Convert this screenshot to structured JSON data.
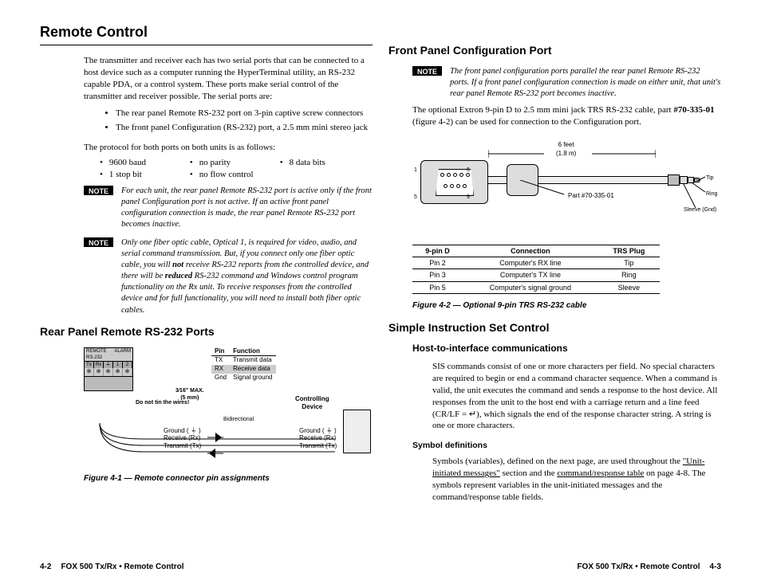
{
  "left": {
    "h1": "Remote Control",
    "intro": "The transmitter and receiver each has two serial ports that can be connected to a host device such as a computer running the HyperTerminal utility, an RS-232 capable PDA, or a control system. These ports make serial control of the transmitter and receiver possible. The serial ports are:",
    "ports": [
      "The rear panel Remote RS-232 port on 3-pin captive screw connectors",
      "The front panel Configuration (RS-232) port, a 2.5 mm mini stereo jack"
    ],
    "protocol_intro": "The protocol for both ports on both units is as follows:",
    "protocol": [
      "9600 baud",
      "no parity",
      "8 data bits",
      "1 stop bit",
      "no flow control"
    ],
    "note_label": "NOTE",
    "note1": "For each unit, the rear panel Remote RS-232 port is active only if the front panel Configuration port is not active. If an active front panel configuration connection is made, the rear panel Remote RS-232 port becomes inactive.",
    "note2_a": "Only one fiber optic cable, Optical 1, is required for video, audio, and serial command transmission. But, if you connect only one fiber optic cable, you will ",
    "note2_not": "not",
    "note2_b": " receive RS-232 reports from the controlled device, and there will be ",
    "note2_red": "reduced",
    "note2_c": " RS-232 command and Windows control program functionality on the Rx unit. To receive responses from the controlled device and for full functionality, you will need to install both fiber optic cables.",
    "h2_rear": "Rear Panel Remote RS-232 Ports",
    "fig41": {
      "remote": "REMOTE\nRS-232",
      "alarm": "ALARM",
      "row": [
        "Tx",
        "Rx",
        "⏚",
        "1",
        "2"
      ],
      "pin_hdr": [
        "Pin",
        "Function"
      ],
      "pins": [
        [
          "TX",
          "Transmit data"
        ],
        [
          "RX",
          "Receive data"
        ],
        [
          "Gnd",
          "Signal ground"
        ]
      ],
      "max1": "3⁄16\" MAX.",
      "max2": "(5 mm)",
      "tin": "Do not tin the wires!",
      "ctrl": "Controlling\nDevice",
      "bidi": "Bidirectional",
      "labels_l": "Ground ( ⏚ )\nReceive (Rx)\nTransmit (Tx)",
      "labels_r": "Ground ( ⏚ )\nReceive (Rx)\nTransmit (Tx)"
    },
    "fig41_caption": "Figure 4-1 — Remote connector pin assignments",
    "footer_page": "4-2",
    "footer_text": "FOX 500 Tx/Rx • Remote Control"
  },
  "right": {
    "h2_front": "Front Panel Configuration Port",
    "note_label": "NOTE",
    "note": "The front panel configuration ports parallel the rear panel Remote RS-232 ports. If a front panel configuration connection is made on either unit, that unit's rear panel Remote RS-232 port becomes inactive.",
    "para_a": "The optional Extron 9-pin D to 2.5 mm mini jack TRS RS-232 cable, part ",
    "para_part": "#70-335-01",
    "para_b": " (figure 4-2) can be used for connection to the Configuration port.",
    "fig42": {
      "len1": "6 feet",
      "len2": "(1.8 m)",
      "part": "Part #70-335-01",
      "pins": {
        "p1": "1",
        "p5": "5",
        "p6": "6",
        "p9": "9"
      },
      "trs": {
        "tip": "Tip",
        "ring": "Ring",
        "sleeve": "Sleeve (Gnd)"
      }
    },
    "table": {
      "headers": [
        "9-pin D",
        "Connection",
        "TRS Plug"
      ],
      "rows": [
        [
          "Pin 2",
          "Computer's RX line",
          "Tip"
        ],
        [
          "Pin 3",
          "Computer's TX line",
          "Ring"
        ],
        [
          "Pin 5",
          "Computer's signal ground",
          "Sleeve"
        ]
      ]
    },
    "fig42_caption": "Figure 4-2 — Optional 9-pin TRS RS-232 cable",
    "h2_sis": "Simple Instruction Set Control",
    "h3_host": "Host-to-interface communications",
    "sis_para": "SIS commands consist of one or more characters per field. No special characters are required to begin or end a command character sequence. When a command is valid, the unit executes the command and sends a response to the host device. All responses from the unit to the host end with a carriage return and a line feed (CR/LF = ↵), which signals the end of the response character string. A string is one or more characters.",
    "h4_sym": "Symbol definitions",
    "sym_a": "Symbols (variables), defined on the next page, are used throughout the ",
    "sym_u1": "\"Unit-initiated messages\"",
    "sym_b": " section and the ",
    "sym_u2": "command/response table",
    "sym_c": " on page 4-8. The symbols represent variables in the unit-initiated messages and the command/response table fields.",
    "footer_text": "FOX 500 Tx/Rx • Remote Control",
    "footer_page": "4-3"
  }
}
